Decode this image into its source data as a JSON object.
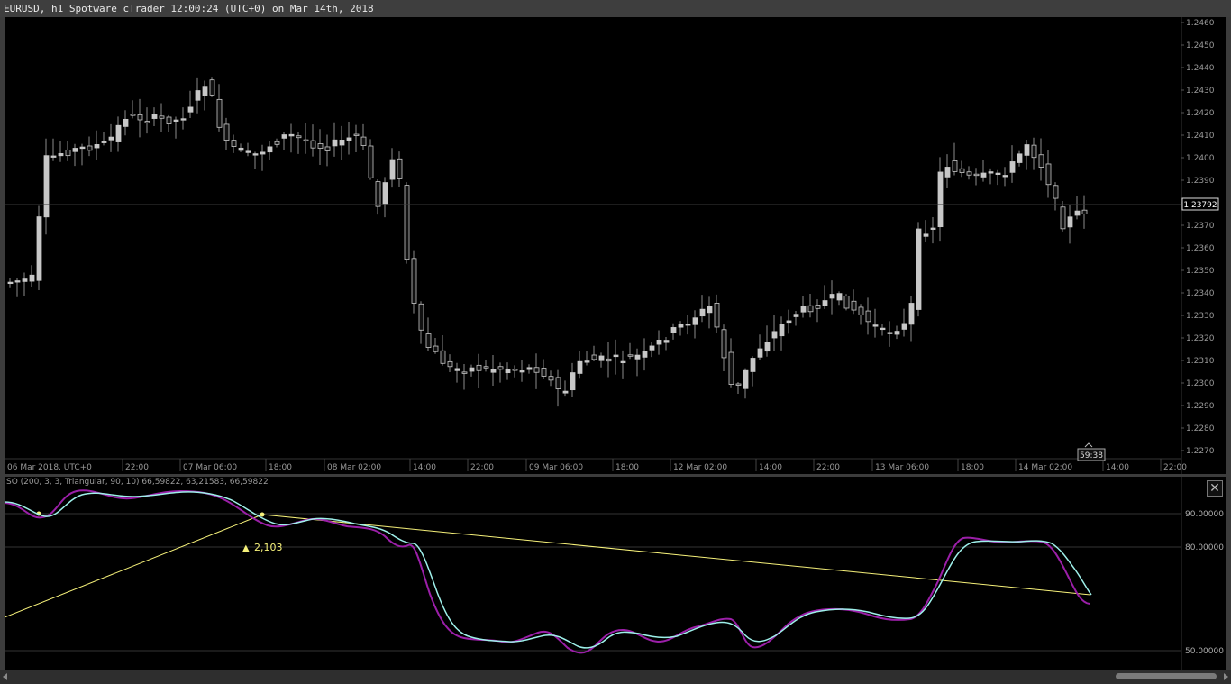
{
  "window": {
    "title": "EURUSD, h1 Spotware cTrader 12:00:24 (UTC+0) on Mar 14th, 2018"
  },
  "main_chart": {
    "price_labels": [
      "1.2460",
      "1.2450",
      "1.2440",
      "1.2430",
      "1.2420",
      "1.2410",
      "1.2400",
      "1.2390",
      "1.2380",
      "1.2370",
      "1.2360",
      "1.2350",
      "1.2340",
      "1.2330",
      "1.2320",
      "1.2310",
      "1.2300",
      "1.2290",
      "1.2280",
      "1.2270"
    ],
    "current_price": "1.23792",
    "countdown": "59:38",
    "time_labels": [
      "06 Mar 2018, UTC+0",
      "22:00",
      "07 Mar 06:00",
      "18:00",
      "08 Mar 02:00",
      "14:00",
      "22:00",
      "09 Mar 06:00",
      "18:00",
      "12 Mar 02:00",
      "14:00",
      "22:00",
      "13 Mar 06:00",
      "18:00",
      "14 Mar 02:00",
      "14:00",
      "22:00"
    ]
  },
  "indicator": {
    "title": "SO (200, 3, 3, Triangular, 90, 10) 66,59822, 63,21583, 66,59822",
    "levels": [
      "90.00000",
      "80.00000",
      "50.00000"
    ],
    "trendline_label": "2,103",
    "close_icon": "close-icon",
    "colors": {
      "k_line": "#9b1fa8",
      "d_line": "#9ef0ea",
      "trend": "#f6f17a"
    }
  },
  "scrollbar": {
    "left_icon": "arrow-left-icon",
    "right_icon": "arrow-right-icon"
  }
}
